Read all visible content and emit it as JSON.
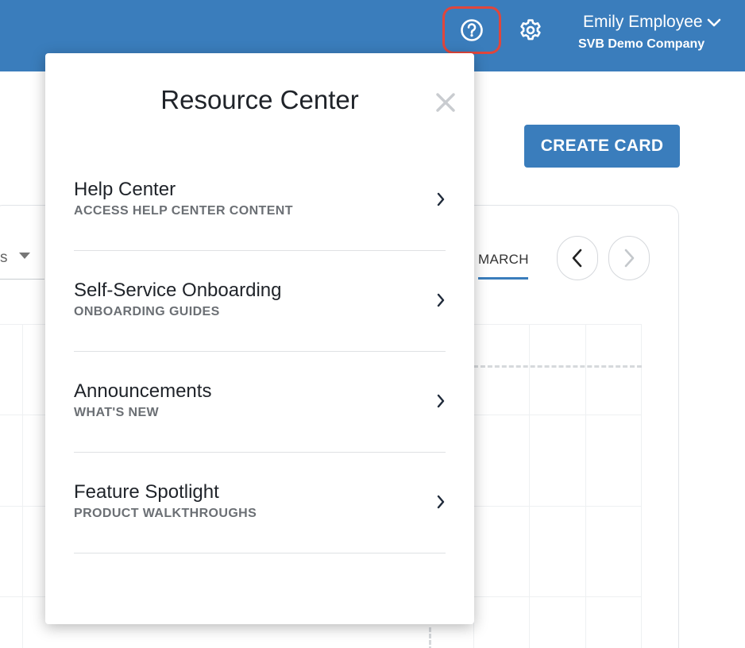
{
  "header": {
    "user_name": "Emily Employee",
    "company_name": "SVB Demo Company",
    "icons": {
      "help": "question-circle-icon",
      "settings": "gear-icon",
      "user_menu": "chevron-down-icon"
    }
  },
  "page": {
    "create_card_label": "CREATE CARD",
    "select_fragment": "s",
    "month_tab_label": "MARCH",
    "nav_icons": [
      "chevron-left-icon",
      "chevron-right-icon"
    ]
  },
  "resource_center": {
    "title": "Resource Center",
    "close_icon": "close-icon",
    "items": [
      {
        "title": "Help Center",
        "subtitle": "ACCESS HELP CENTER CONTENT"
      },
      {
        "title": "Self-Service Onboarding",
        "subtitle": "ONBOARDING GUIDES"
      },
      {
        "title": "Announcements",
        "subtitle": "WHAT'S NEW"
      },
      {
        "title": "Feature Spotlight",
        "subtitle": "PRODUCT WALKTHROUGHS"
      }
    ]
  },
  "colors": {
    "brand_blue": "#3a7dbc",
    "highlight_red": "#e0463c",
    "text_dark": "#1f2329",
    "text_muted": "#6b6f74"
  }
}
